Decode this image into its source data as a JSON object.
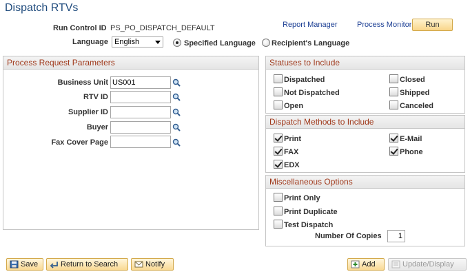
{
  "page": {
    "title": "Dispatch RTVs"
  },
  "run_control": {
    "label": "Run Control ID",
    "value": "PS_PO_DISPATCH_DEFAULT",
    "report_manager": "Report Manager",
    "process_monitor": "Process Monitor",
    "run_label": "Run"
  },
  "language": {
    "label": "Language",
    "selected": "English",
    "specified": "Specified Language",
    "recipients": "Recipient's Language",
    "specified_selected": true
  },
  "params": {
    "title": "Process Request Parameters",
    "fields": [
      {
        "label": "Business Unit",
        "value": "US001"
      },
      {
        "label": "RTV ID",
        "value": ""
      },
      {
        "label": "Supplier ID",
        "value": ""
      },
      {
        "label": "Buyer",
        "value": ""
      },
      {
        "label": "Fax Cover Page",
        "value": ""
      }
    ]
  },
  "statuses": {
    "title": "Statuses to Include",
    "items": [
      {
        "label": "Dispatched",
        "checked": false
      },
      {
        "label": "Closed",
        "checked": false
      },
      {
        "label": "Not Dispatched",
        "checked": false
      },
      {
        "label": "Shipped",
        "checked": false
      },
      {
        "label": "Open",
        "checked": false
      },
      {
        "label": "Canceled",
        "checked": false
      }
    ]
  },
  "methods": {
    "title": "Dispatch Methods to Include",
    "items": [
      {
        "label": "Print",
        "checked": true
      },
      {
        "label": "E-Mail",
        "checked": true
      },
      {
        "label": "FAX",
        "checked": true
      },
      {
        "label": "Phone",
        "checked": true
      },
      {
        "label": "EDX",
        "checked": true
      }
    ]
  },
  "misc": {
    "title": "Miscellaneous Options",
    "items": [
      {
        "label": "Print Only",
        "checked": false
      },
      {
        "label": "Print Duplicate",
        "checked": false
      },
      {
        "label": "Test Dispatch",
        "checked": false
      }
    ],
    "copies_label": "Number Of Copies",
    "copies_value": "1"
  },
  "toolbar": {
    "save": "Save",
    "return": "Return to Search",
    "notify": "Notify",
    "add": "Add",
    "update": "Update/Display"
  },
  "icons": {
    "lookup": "magnifier-icon",
    "save": "save-icon",
    "return": "return-search-icon",
    "notify": "notify-icon",
    "add": "add-icon",
    "update": "update-display-icon"
  }
}
